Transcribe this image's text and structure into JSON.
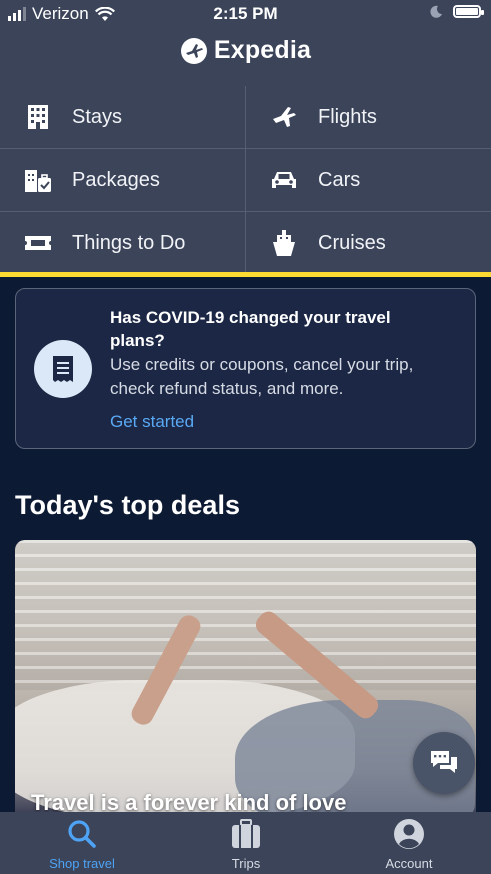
{
  "status_bar": {
    "carrier": "Verizon",
    "time": "2:15 PM"
  },
  "header": {
    "logo_text": "Expedia"
  },
  "nav": {
    "items": [
      {
        "label": "Stays",
        "icon": "building-icon"
      },
      {
        "label": "Flights",
        "icon": "airplane-icon"
      },
      {
        "label": "Packages",
        "icon": "packages-icon"
      },
      {
        "label": "Cars",
        "icon": "car-icon"
      },
      {
        "label": "Things to Do",
        "icon": "ticket-icon"
      },
      {
        "label": "Cruises",
        "icon": "ship-icon"
      }
    ]
  },
  "covid_card": {
    "title": "Has COVID-19 changed your travel plans?",
    "description": "Use credits or coupons, cancel your trip, check refund status, and more.",
    "link": "Get started",
    "icon": "receipt-icon"
  },
  "deals": {
    "heading": "Today's top deals",
    "card_caption": "Travel is a forever kind of love"
  },
  "tab_bar": {
    "tabs": [
      {
        "label": "Shop travel",
        "icon": "search-icon",
        "active": true
      },
      {
        "label": "Trips",
        "icon": "suitcase-icon",
        "active": false
      },
      {
        "label": "Account",
        "icon": "account-icon",
        "active": false
      }
    ]
  },
  "colors": {
    "header_bg": "#3b4459",
    "page_bg": "#0d1a33",
    "accent_yellow": "#fddb32",
    "link_blue": "#5aa9f5"
  }
}
